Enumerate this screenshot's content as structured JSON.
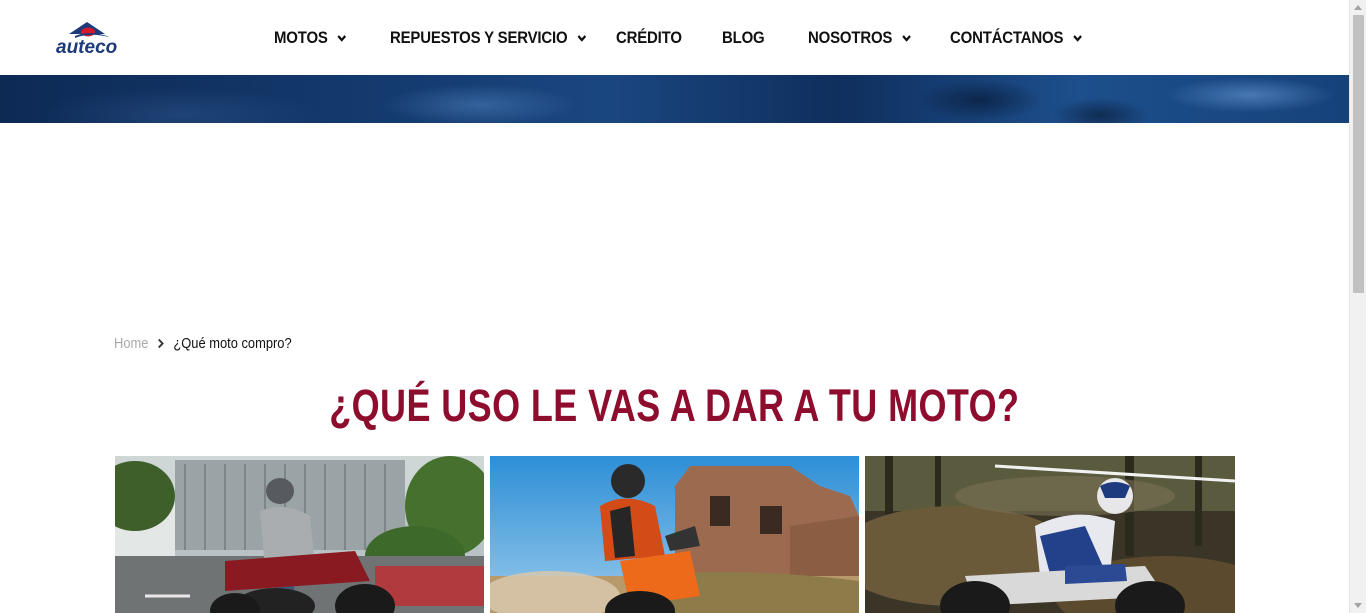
{
  "header": {
    "logo_text": "auteco",
    "nav": [
      {
        "label": "MOTOS",
        "has_dropdown": true
      },
      {
        "label": "REPUESTOS Y SERVICIO",
        "has_dropdown": true
      },
      {
        "label": "CRÉDITO",
        "has_dropdown": false
      },
      {
        "label": "BLOG",
        "has_dropdown": false
      },
      {
        "label": "NOSOTROS",
        "has_dropdown": true
      },
      {
        "label": "CONTÁCTANOS",
        "has_dropdown": true
      }
    ]
  },
  "breadcrumb": {
    "home": "Home",
    "current": "¿Qué moto compro?"
  },
  "main": {
    "headline": "¿QUÉ USO LE VAS A DAR A TU MOTO?"
  },
  "colors": {
    "headline": "#8e0c2d",
    "logo_blue": "#1d3a7a",
    "logo_red": "#d6192a",
    "hero_blue": "#13386b"
  }
}
